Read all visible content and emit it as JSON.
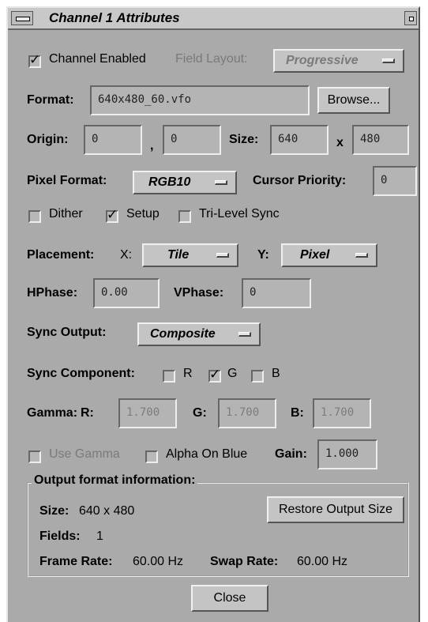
{
  "window": {
    "title": "Channel 1 Attributes"
  },
  "channel_enabled": {
    "label": "Channel Enabled",
    "checked": true
  },
  "field_layout": {
    "label": "Field Layout:",
    "value": "Progressive"
  },
  "format": {
    "label": "Format:",
    "value": "640x480_60.vfo",
    "browse_label": "Browse..."
  },
  "origin": {
    "label": "Origin:",
    "x": "0",
    "separator": ",",
    "y": "0"
  },
  "size": {
    "label": "Size:",
    "width": "640",
    "x_label": "x",
    "height": "480"
  },
  "pixel_format": {
    "label": "Pixel Format:",
    "value": "RGB10"
  },
  "cursor_priority": {
    "label": "Cursor Priority:",
    "value": "0"
  },
  "options": {
    "dither": {
      "label": "Dither",
      "checked": false
    },
    "setup": {
      "label": "Setup",
      "checked": true
    },
    "tri_level_sync": {
      "label": "Tri-Level Sync",
      "checked": false
    }
  },
  "placement": {
    "label": "Placement:",
    "x_label": "X:",
    "x_value": "Tile",
    "y_label": "Y:",
    "y_value": "Pixel"
  },
  "hphase": {
    "label": "HPhase:",
    "value": "0.00"
  },
  "vphase": {
    "label": "VPhase:",
    "value": "0"
  },
  "sync_output": {
    "label": "Sync Output:",
    "value": "Composite"
  },
  "sync_component": {
    "label": "Sync Component:",
    "r": {
      "label": "R",
      "checked": false
    },
    "g": {
      "label": "G",
      "checked": true
    },
    "b": {
      "label": "B",
      "checked": false
    }
  },
  "gamma": {
    "label": "Gamma:",
    "r_label": "R:",
    "r_value": "1.700",
    "g_label": "G:",
    "g_value": "1.700",
    "b_label": "B:",
    "b_value": "1.700"
  },
  "use_gamma": {
    "label": "Use Gamma",
    "checked": false
  },
  "alpha_on_blue": {
    "label": "Alpha On Blue",
    "checked": false
  },
  "gain": {
    "label": "Gain:",
    "value": "1.000"
  },
  "output_info": {
    "title": "Output format information:",
    "size_label": "Size:",
    "size_value": "640 x 480",
    "restore_label": "Restore Output Size",
    "fields_label": "Fields:",
    "fields_value": "1",
    "frame_rate_label": "Frame Rate:",
    "frame_rate_value": "60.00 Hz",
    "swap_rate_label": "Swap Rate:",
    "swap_rate_value": "60.00 Hz"
  },
  "close_label": "Close"
}
